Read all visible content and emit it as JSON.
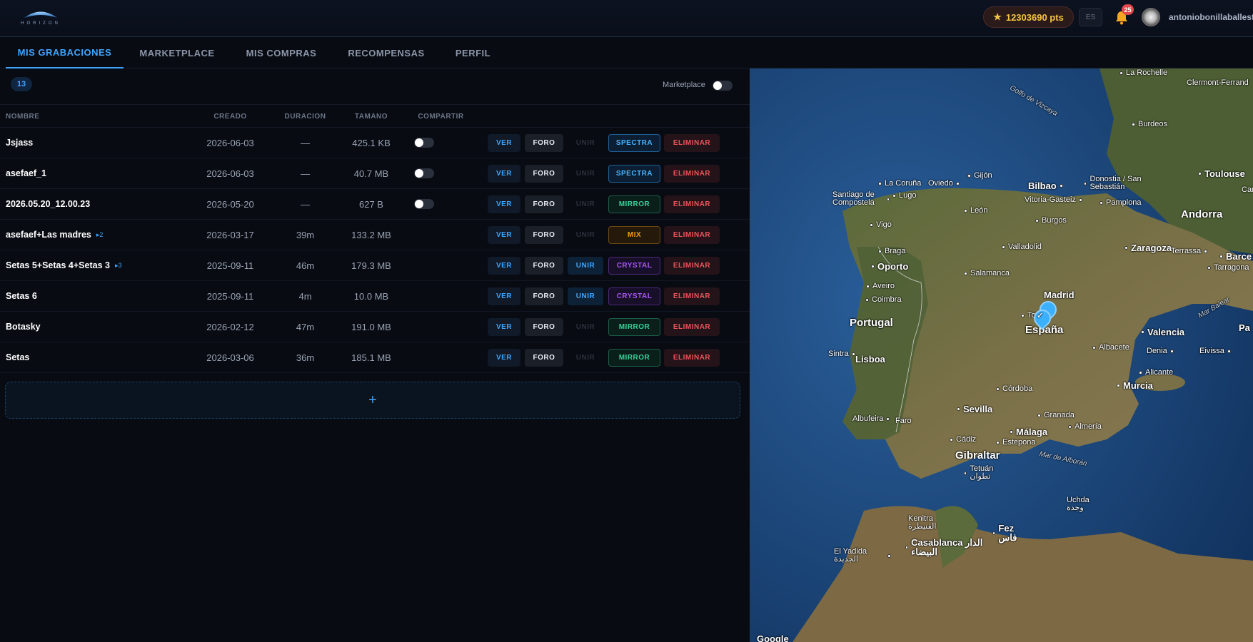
{
  "header": {
    "brand": "HORIZON",
    "points": "12303690 pts",
    "language": "ES",
    "notifications": "25",
    "username": "antoniobonillaballest"
  },
  "tabs": [
    {
      "label": "MIS GRABACIONES",
      "active": true
    },
    {
      "label": "MARKETPLACE"
    },
    {
      "label": "MIS COMPRAS"
    },
    {
      "label": "RECOMPENSAS"
    },
    {
      "label": "PERFIL"
    }
  ],
  "toolbar": {
    "count": "13",
    "marketplace_label": "Marketplace"
  },
  "table": {
    "columns": [
      "NOMBRE",
      "CREADO",
      "DURACION",
      "TAMANO",
      "COMPARTIR"
    ],
    "rows": [
      {
        "name": "Jsjass",
        "sub": "",
        "created": "2026-06-03",
        "duration": "—",
        "size": "425.1 KB",
        "share": true,
        "unir_enabled": false,
        "tag": "SPECTRA",
        "tag_kind": "spectra"
      },
      {
        "name": "asefaef_1",
        "sub": "",
        "created": "2026-06-03",
        "duration": "—",
        "size": "40.7 MB",
        "share": true,
        "unir_enabled": false,
        "tag": "SPECTRA",
        "tag_kind": "spectra"
      },
      {
        "name": "2026.05.20_12.00.23",
        "sub": "",
        "created": "2026-05-20",
        "duration": "—",
        "size": "627 B",
        "share": true,
        "unir_enabled": false,
        "tag": "MIRROR",
        "tag_kind": "mirror"
      },
      {
        "name": "asefaef+Las madres",
        "sub": "▸2",
        "created": "2026-03-17",
        "duration": "39m",
        "size": "133.2 MB",
        "share": false,
        "unir_enabled": false,
        "tag": "MIX",
        "tag_kind": "mix"
      },
      {
        "name": "Setas 5+Setas 4+Setas 3",
        "sub": "▸3",
        "created": "2025-09-11",
        "duration": "46m",
        "size": "179.3 MB",
        "share": false,
        "unir_enabled": true,
        "tag": "CRYSTAL",
        "tag_kind": "crystal"
      },
      {
        "name": "Setas 6",
        "sub": "",
        "created": "2025-09-11",
        "duration": "4m",
        "size": "10.0 MB",
        "share": false,
        "unir_enabled": true,
        "tag": "CRYSTAL",
        "tag_kind": "crystal"
      },
      {
        "name": "Botasky",
        "sub": "",
        "created": "2026-02-12",
        "duration": "47m",
        "size": "191.0 MB",
        "share": false,
        "unir_enabled": false,
        "tag": "MIRROR",
        "tag_kind": "mirror"
      },
      {
        "name": "Setas",
        "sub": "",
        "created": "2026-03-06",
        "duration": "36m",
        "size": "185.1 MB",
        "share": false,
        "unir_enabled": false,
        "tag": "MIRROR",
        "tag_kind": "mirror"
      }
    ],
    "actions": {
      "ver": "VER",
      "foro": "FORO",
      "unir": "UNIR",
      "eliminar": "ELIMINAR"
    }
  },
  "add_button": "+",
  "map": {
    "attribution": "Google",
    "labels": [
      {
        "text": "La Rochelle",
        "kind": "city"
      },
      {
        "text": "Clermont-Ferrand",
        "kind": "plain"
      },
      {
        "text": "Golfo de Vizcaya",
        "kind": "water"
      },
      {
        "text": "Burdeos",
        "kind": "city"
      },
      {
        "text": "Toulouse",
        "kind": "city"
      },
      {
        "text": "Carca",
        "kind": "plain"
      },
      {
        "text": "La Coruña",
        "kind": "city"
      },
      {
        "text": "Oviedo",
        "kind": "city"
      },
      {
        "text": "Gijón",
        "kind": "city"
      },
      {
        "text": "Bilbao",
        "kind": "med"
      },
      {
        "text": "Donostia / San Sebastián",
        "kind": "city"
      },
      {
        "text": "Santiago de Compostela",
        "kind": "city"
      },
      {
        "text": "Lugo",
        "kind": "city"
      },
      {
        "text": "Vitoria-Gasteiz",
        "kind": "city"
      },
      {
        "text": "Pamplona",
        "kind": "city"
      },
      {
        "text": "Andorra",
        "kind": "big"
      },
      {
        "text": "León",
        "kind": "city"
      },
      {
        "text": "Burgos",
        "kind": "city"
      },
      {
        "text": "Vigo",
        "kind": "city"
      },
      {
        "text": "Valladolid",
        "kind": "city"
      },
      {
        "text": "Zaragoza",
        "kind": "med"
      },
      {
        "text": "Terrassa",
        "kind": "city"
      },
      {
        "text": "Barce",
        "kind": "med"
      },
      {
        "text": "Braga",
        "kind": "city"
      },
      {
        "text": "Oporto",
        "kind": "med"
      },
      {
        "text": "Salamanca",
        "kind": "city"
      },
      {
        "text": "Tarragona",
        "kind": "city"
      },
      {
        "text": "Aveiro",
        "kind": "city"
      },
      {
        "text": "Madrid",
        "kind": "med"
      },
      {
        "text": "Mar Balear",
        "kind": "water"
      },
      {
        "text": "Coimbra",
        "kind": "city"
      },
      {
        "text": "Toledo",
        "kind": "city"
      },
      {
        "text": "Portugal",
        "kind": "big"
      },
      {
        "text": "España",
        "kind": "big"
      },
      {
        "text": "Valencia",
        "kind": "med"
      },
      {
        "text": "Pa",
        "kind": "plain"
      },
      {
        "text": "Sintra",
        "kind": "city"
      },
      {
        "text": "Lisboa",
        "kind": "med"
      },
      {
        "text": "Albacete",
        "kind": "city"
      },
      {
        "text": "Denia",
        "kind": "city"
      },
      {
        "text": "Eivissa",
        "kind": "city"
      },
      {
        "text": "Alicante",
        "kind": "city"
      },
      {
        "text": "Córdoba",
        "kind": "city"
      },
      {
        "text": "Murcia",
        "kind": "med"
      },
      {
        "text": "Sevilla",
        "kind": "med"
      },
      {
        "text": "Albufeira",
        "kind": "city"
      },
      {
        "text": "Faro",
        "kind": "city"
      },
      {
        "text": "Granada",
        "kind": "city"
      },
      {
        "text": "Málaga",
        "kind": "med"
      },
      {
        "text": "Almería",
        "kind": "city"
      },
      {
        "text": "Cádiz",
        "kind": "city"
      },
      {
        "text": "Estepona",
        "kind": "city"
      },
      {
        "text": "Gibraltar",
        "kind": "big"
      },
      {
        "text": "Mar de Alborán",
        "kind": "water"
      },
      {
        "text": "Tetuán تطوان",
        "kind": "city"
      },
      {
        "text": "Uchda وجدة",
        "kind": "city"
      },
      {
        "text": "Kenitra القنيطرة",
        "kind": "city"
      },
      {
        "text": "Fez فاس",
        "kind": "med"
      },
      {
        "text": "Casablanca الدار البيضاء",
        "kind": "med"
      },
      {
        "text": "El Yadida الجديدة",
        "kind": "city"
      }
    ]
  },
  "colors": {
    "accent": "#3ea6ff",
    "danger": "#f0525a",
    "gold": "#f5c542"
  }
}
